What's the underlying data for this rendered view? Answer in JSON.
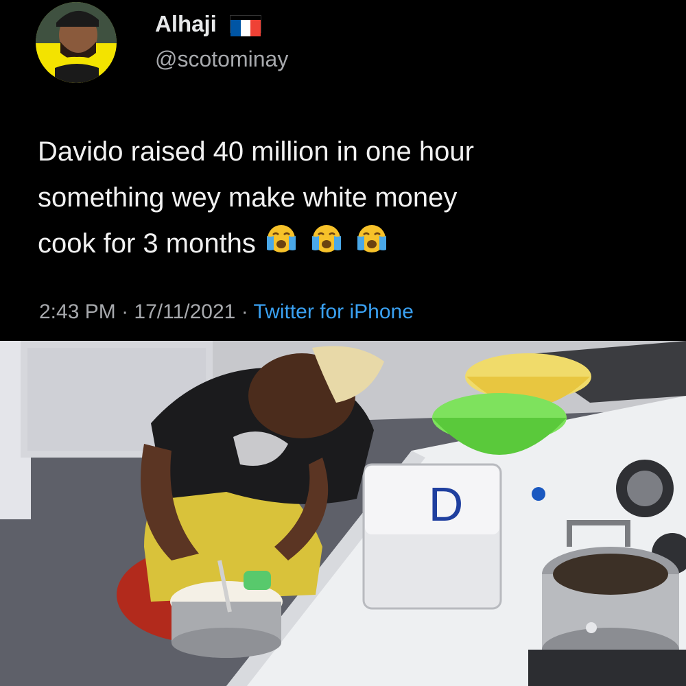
{
  "tweet": {
    "display_name": "Alhaji",
    "flag_icon": "france-flag-icon",
    "handle": "@scotominay",
    "text_lines": [
      "Davido raised 40 million in one hour",
      "something wey make white money",
      "cook for 3 months"
    ],
    "emoji_icon": "loudly-crying-face-icon",
    "time": "2:43 PM",
    "date": "17/11/2021",
    "separator": "·",
    "source": "Twitter for iPhone"
  },
  "photo": {
    "container_label": "D"
  },
  "colors": {
    "background": "#000000",
    "link": "#3aa1f2",
    "secondary_text": "#a7a9ad",
    "avatar_ring": "#f3e300"
  }
}
